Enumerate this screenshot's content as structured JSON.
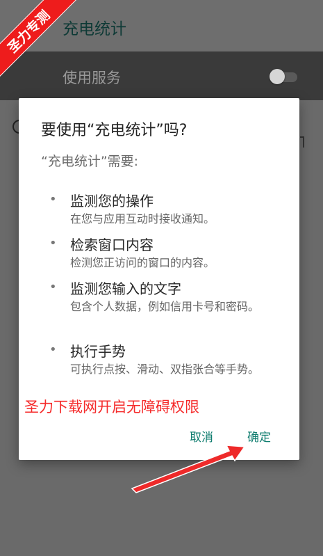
{
  "ribbon": {
    "text": "圣力专测"
  },
  "app": {
    "title": "充电统计"
  },
  "service": {
    "label": "使用服务",
    "enabled": false
  },
  "dialog": {
    "title": "要使用“充电统计”吗?",
    "subtitle": "“充电统计”需要:",
    "bullet": "•",
    "permissions": [
      {
        "title": "监测您的操作",
        "desc": "在您与应用互动时接收通知。"
      },
      {
        "title": "检索窗口内容",
        "desc": "检测您正访问的窗口的内容。"
      },
      {
        "title": "监测您输入的文字",
        "desc": "包含个人数据，例如信用卡号和密码。"
      },
      {
        "title": "执行手势",
        "desc": "可执行点按、滑动、双指张合等手势。"
      }
    ],
    "promo": "圣力下载网开启无障碍权限",
    "cancel_label": "取消",
    "ok_label": "确定"
  },
  "colors": {
    "accent": "#0f7d6f",
    "promo": "#f52a2a",
    "ribbon": "#ee1c1c"
  }
}
